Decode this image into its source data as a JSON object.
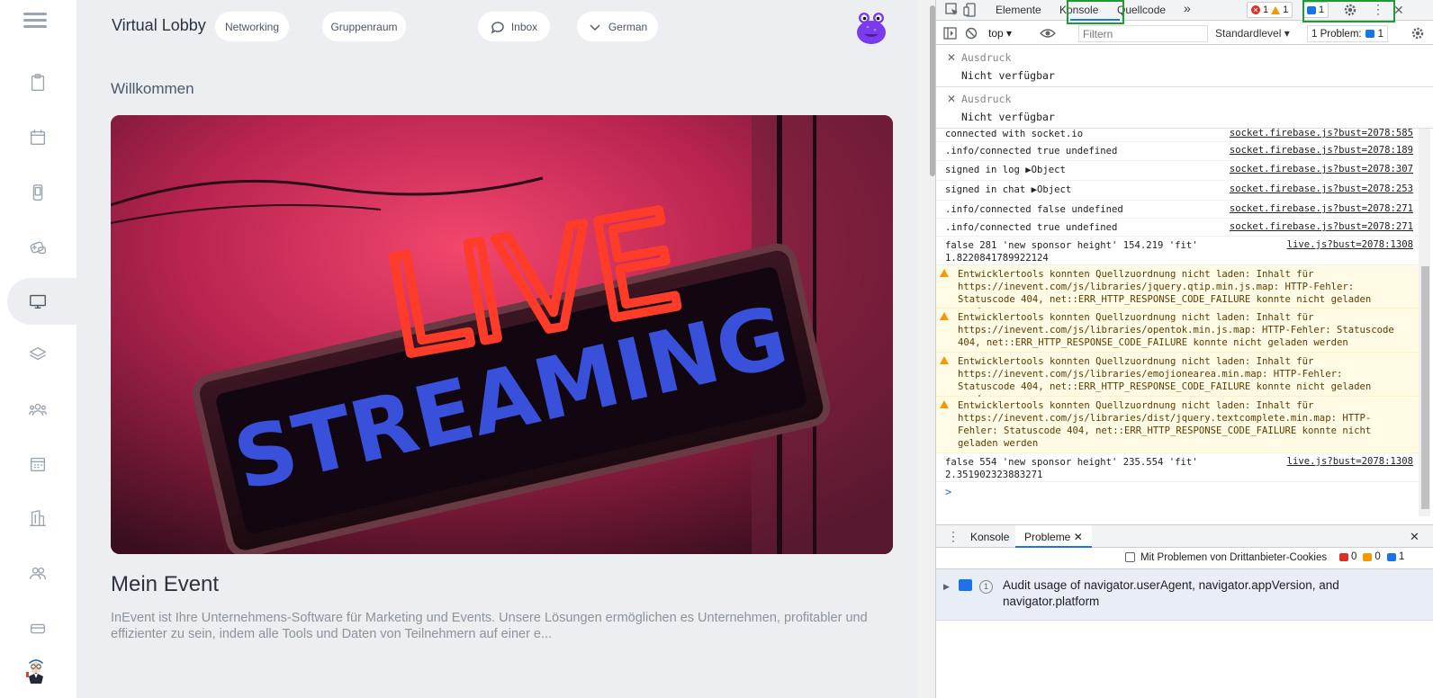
{
  "app": {
    "title": "Virtual Lobby",
    "nav_pills": [
      "Networking",
      "Gruppenraum"
    ],
    "inbox_label": "Inbox",
    "language_label": "German",
    "welcome": "Willkommen",
    "hero_text_top": "LIVE",
    "hero_text_bottom": "STREAMING",
    "event_title": "Mein Event",
    "event_description": "InEvent ist Ihre Unternehmens-Software für Marketing und Events. Unsere Lösungen ermöglichen es Unternehmen, profitabler und effizienter zu sein, indem alle Tools und Daten von Teilnehmern auf einer e..."
  },
  "sidebar": {
    "icons": [
      "menu-icon",
      "clipboard-icon",
      "calendar-icon",
      "phone-icon",
      "gamepad-icon",
      "monitor-icon",
      "layers-icon",
      "people-group-icon",
      "calendar-grid-icon",
      "building-icon",
      "users-icon",
      "ticket-icon"
    ],
    "active": "monitor-icon"
  },
  "devtools": {
    "tabs": [
      "Elemente",
      "Konsole",
      "Quellcode"
    ],
    "active_tab": "Konsole",
    "more": "»",
    "counters": {
      "errors": "1",
      "warnings": "1",
      "info": "1"
    },
    "toolbar": {
      "context": "top",
      "filter_placeholder": "Filtern",
      "level": "Standardlevel",
      "problems": "1 Problem:",
      "problems_count": "1"
    },
    "expressions": [
      {
        "label": "Ausdruck",
        "value": "Nicht verfügbar"
      },
      {
        "label": "Ausdruck",
        "value": "Nicht verfügbar"
      }
    ],
    "logs": [
      {
        "msg": "connected with socket.io",
        "src": "socket.firebase.js?bust=2078:585"
      },
      {
        "msg": ".info/connected true undefined",
        "src": "socket.firebase.js?bust=2078:189"
      },
      {
        "msg": "signed in log ▶Object",
        "src": "socket.firebase.js?bust=2078:307"
      },
      {
        "msg": "signed in chat ▶Object",
        "src": "socket.firebase.js?bust=2078:253"
      },
      {
        "msg": ".info/connected false undefined",
        "src": "socket.firebase.js?bust=2078:271"
      },
      {
        "msg": ".info/connected true undefined",
        "src": "socket.firebase.js?bust=2078:271"
      },
      {
        "msg": "false 281 'new sponsor height' 154.219 'fit'\n1.8220841789922124",
        "src": "live.js?bust=2078:1308"
      },
      {
        "msg": "Entwicklertools konnten Quellzuordnung nicht laden: Inhalt für https://inevent.com/js/libraries/jquery.qtip.min.js.map: HTTP-Fehler: Statuscode 404, net::ERR_HTTP_RESPONSE_CODE_FAILURE konnte nicht geladen werden",
        "src": ""
      },
      {
        "msg": "Entwicklertools konnten Quellzuordnung nicht laden: Inhalt für https://inevent.com/js/libraries/opentok.min.js.map: HTTP-Fehler: Statuscode 404, net::ERR_HTTP_RESPONSE_CODE_FAILURE konnte nicht geladen werden",
        "src": ""
      },
      {
        "msg": "Entwicklertools konnten Quellzuordnung nicht laden: Inhalt für https://inevent.com/js/libraries/emojionearea.min.map: HTTP-Fehler: Statuscode 404, net::ERR_HTTP_RESPONSE_CODE_FAILURE konnte nicht geladen werden",
        "src": ""
      },
      {
        "msg": "Entwicklertools konnten Quellzuordnung nicht laden: Inhalt für https://inevent.com/js/libraries/dist/jquery.textcomplete.min.map: HTTP-Fehler: Statuscode 404, net::ERR_HTTP_RESPONSE_CODE_FAILURE konnte nicht geladen werden",
        "src": ""
      },
      {
        "msg": "false 554 'new sponsor height' 235.554 'fit'\n2.351902323883271",
        "src": "live.js?bust=2078:1308"
      }
    ],
    "prompt": ">",
    "drawer": {
      "tabs": [
        "Konsole",
        "Probleme"
      ],
      "active_tab": "Probleme",
      "third_party_checkbox": "Mit Problemen von Drittanbieter-Cookies",
      "counts": {
        "errors": "0",
        "warnings": "0",
        "info": "1"
      },
      "issue_count": "1",
      "issue_text": "Audit usage of navigator.userAgent, navigator.appVersion, and navigator.platform"
    }
  }
}
